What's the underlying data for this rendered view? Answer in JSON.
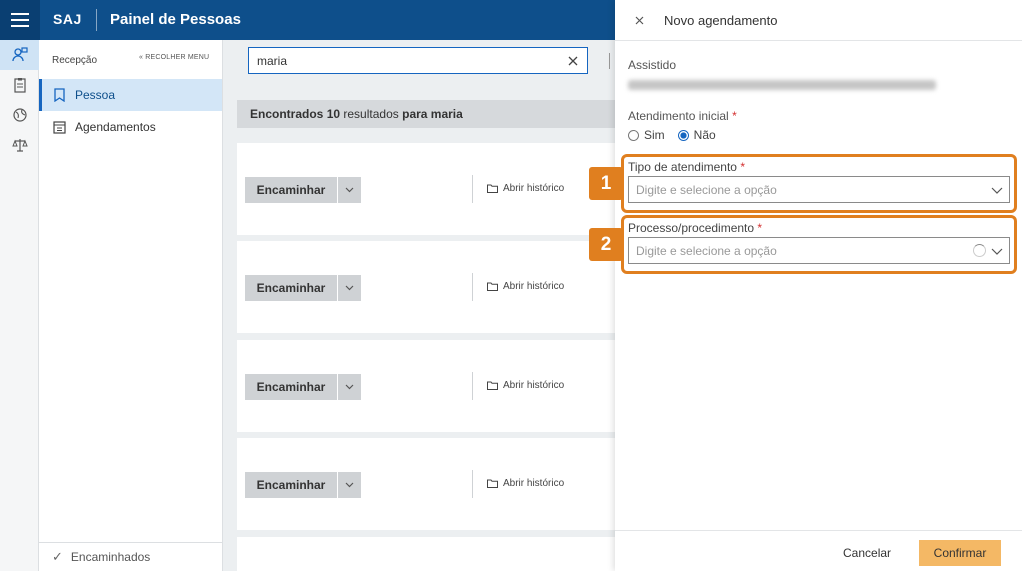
{
  "header": {
    "brand": "SAJ",
    "title": "Painel de Pessoas"
  },
  "rail": {
    "icons": [
      "people-icon",
      "clipboard-icon",
      "globe-icon",
      "scales-icon"
    ]
  },
  "menu": {
    "heading": "Recepção",
    "collapse_label": "RECOLHER MENU",
    "items": [
      {
        "label": "Pessoa",
        "icon": "bookmark-icon",
        "active": true
      },
      {
        "label": "Agendamentos",
        "icon": "calendar-icon",
        "active": false
      }
    ],
    "footer_label": "Encaminhados"
  },
  "search": {
    "value": "maria"
  },
  "results": {
    "prefix": "Encontrados",
    "count": "10",
    "middle": "resultados",
    "for": "para maria"
  },
  "cards": [
    {
      "forward_label": "Encaminhar",
      "history_label": "Abrir histórico"
    },
    {
      "forward_label": "Encaminhar",
      "history_label": "Abrir histórico"
    },
    {
      "forward_label": "Encaminhar",
      "history_label": "Abrir histórico"
    },
    {
      "forward_label": "Encaminhar",
      "history_label": "Abrir histórico"
    }
  ],
  "panel": {
    "title": "Novo agendamento",
    "assistido_label": "Assistido",
    "atendimento_label": "Atendimento inicial",
    "required_mark": "*",
    "option_yes": "Sim",
    "option_no": "Não",
    "selected": "Não",
    "tipo_label": "Tipo de atendimento",
    "tipo_placeholder": "Digite e selecione a opção",
    "processo_label": "Processo/procedimento",
    "processo_placeholder": "Digite e selecione a opção",
    "cancel_label": "Cancelar",
    "confirm_label": "Confirmar"
  },
  "badges": [
    "1",
    "2"
  ],
  "colors": {
    "header": "#0e4f8b",
    "accent": "#1565c0",
    "highlight": "#e07f1f",
    "confirm": "#f4b865"
  }
}
